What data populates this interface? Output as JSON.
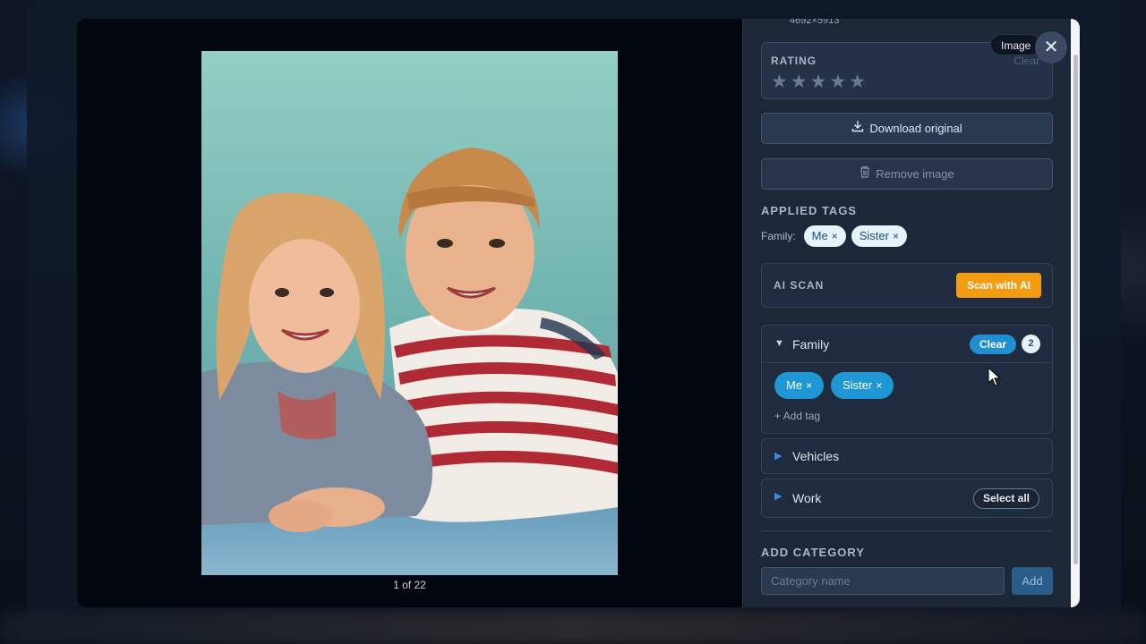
{
  "viewer": {
    "counter": "1 of 22",
    "photo_alt": "Portrait photo"
  },
  "panel": {
    "dimensions": "4692×5913",
    "tooltip": "Image",
    "close_icon": "close-icon",
    "rating": {
      "title": "RATING",
      "clear_label": "Clear",
      "stars": "★★★★★",
      "value": 0,
      "max": 5
    },
    "download_label": "Download original",
    "remove_label": "Remove image",
    "applied_tags": {
      "title": "APPLIED TAGS",
      "category_label": "Family:",
      "tags": [
        "Me",
        "Sister"
      ]
    },
    "ai_scan": {
      "title": "AI SCAN",
      "button_label": "Scan with AI"
    },
    "categories": [
      {
        "name": "Family",
        "expanded": true,
        "clear_label": "Clear",
        "count": "2",
        "tags": [
          "Me",
          "Sister"
        ],
        "add_tag_label": "+ Add tag"
      },
      {
        "name": "Vehicles",
        "expanded": false
      },
      {
        "name": "Work",
        "expanded": false,
        "select_all_label": "Select all"
      }
    ],
    "add_category": {
      "title": "ADD CATEGORY",
      "placeholder": "Category name",
      "button_label": "Add"
    }
  },
  "colors": {
    "accent_blue": "#1f97d4",
    "scan_orange": "#f39c12",
    "panel_bg": "#1c2738"
  },
  "glyphs": {
    "remove_x": "×",
    "triangle_down": "▼",
    "triangle_right": "▶"
  }
}
